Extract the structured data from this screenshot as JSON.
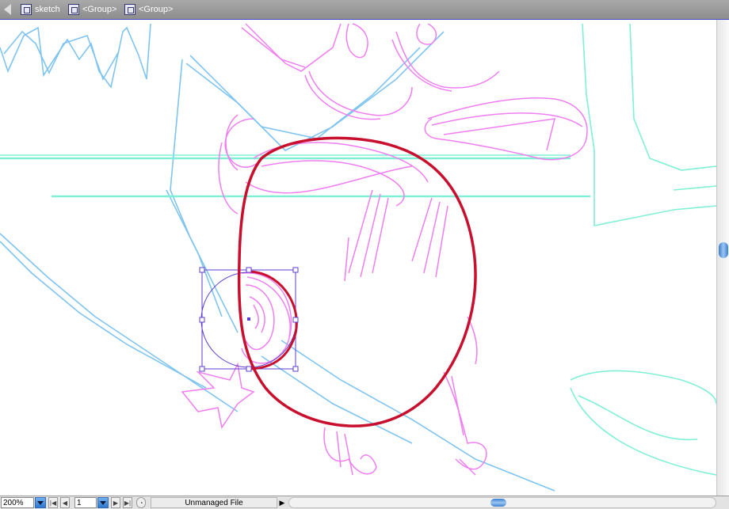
{
  "breadcrumb": [
    {
      "label": "sketch",
      "icon": "layer-icon"
    },
    {
      "label": "<Group>",
      "icon": "group-icon"
    },
    {
      "label": "<Group>",
      "icon": "group-icon"
    }
  ],
  "status_bar": {
    "zoom": "200%",
    "page": "1",
    "status_text": "Unmanaged File"
  },
  "colors": {
    "sketch_blue": "#7fc4f0",
    "sketch_magenta": "#ef7ef0",
    "sketch_teal": "#7ff0d6",
    "stroke_red": "#c8102e",
    "selection": "#5c3cd0"
  }
}
